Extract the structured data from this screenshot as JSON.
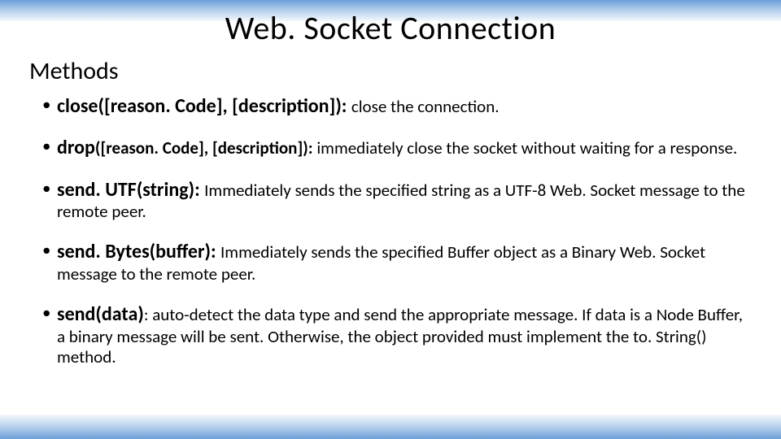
{
  "title": "Web. Socket Connection",
  "subtitle": "Methods",
  "methods": [
    {
      "signature": "close([reason. Code], [description]): ",
      "desc": "close the connection."
    },
    {
      "signature": "drop",
      "sig_tail": "([reason. Code], [description]): ",
      "desc": "immediately close the socket without waiting for a response."
    },
    {
      "signature": "send. UTF(string): ",
      "desc": "Immediately sends the specified string as a UTF-8 Web. Socket message to the remote peer."
    },
    {
      "signature": "send. Bytes(buffer): ",
      "desc": "Immediately sends the specified Buffer object as a Binary Web. Socket message to the remote peer."
    },
    {
      "signature": "send(data)",
      "sig_tail": ": ",
      "desc": "auto-detect the data type and send the appropriate message. If data is a Node Buffer, a binary message will be sent. Otherwise, the object provided must implement the to. String() method."
    }
  ]
}
